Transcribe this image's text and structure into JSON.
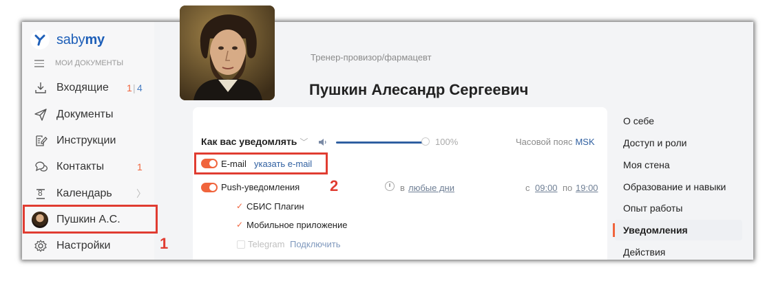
{
  "brand": {
    "name_regular": "saby",
    "name_bold": "my"
  },
  "sidebar": {
    "section_label": "МОИ ДОКУМЕНТЫ",
    "items": [
      {
        "label": "Входящие",
        "count_a": "1",
        "sep": "|",
        "count_b": "4",
        "icon": "download-icon"
      },
      {
        "label": "Документы",
        "icon": "paper-plane-icon"
      },
      {
        "label": "Инструкции",
        "icon": "edit-document-icon"
      },
      {
        "label": "Контакты",
        "count_a": "1",
        "icon": "chat-bubbles-icon"
      },
      {
        "label": "Календарь",
        "icon": "calendar-icon",
        "calendar_day": "8",
        "chevron": "〉"
      },
      {
        "label": "Пушкин А.С.",
        "icon": "avatar"
      },
      {
        "label": "Настройки",
        "icon": "gear-icon"
      }
    ]
  },
  "profile": {
    "role": "Тренер-провизор/фармацевт",
    "full_name": "Пушкин Алесандр Сергеевич"
  },
  "notifications": {
    "heading": "Как вас уведомлять",
    "heading_chevron": "﹀",
    "volume_icon": "speaker-icon",
    "volume_percent": "100%",
    "volume_level": 1.0,
    "timezone_label": "Часовой пояс",
    "timezone_value": "MSK",
    "email_label": "E-mail",
    "email_link": "указать e-mail",
    "push_label": "Push-уведомления",
    "schedule_prefix": "в",
    "schedule_days": "любые дни",
    "time_from_label": "с",
    "time_from": "09:00",
    "time_to_label": "по",
    "time_to": "19:00",
    "channels": [
      {
        "label": "СБИС Плагин",
        "checked": true
      },
      {
        "label": "Мобильное приложение",
        "checked": true
      }
    ],
    "telegram_label": "Telegram",
    "telegram_link": "Подключить"
  },
  "right_nav": {
    "items": [
      "О себе",
      "Доступ и роли",
      "Моя стена",
      "Образование и навыки",
      "Опыт работы",
      "Уведомления",
      "Действия"
    ],
    "active": "Уведомления"
  },
  "annotations": {
    "one": "1",
    "two": "2"
  },
  "colors": {
    "accent": "#f0643c",
    "link": "#2f5fa0",
    "highlight": "#e03c31",
    "brand": "#1e5fb8"
  }
}
